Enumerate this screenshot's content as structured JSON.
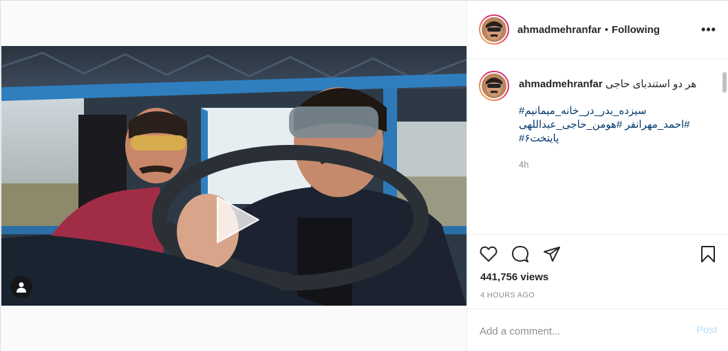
{
  "post": {
    "views": "441,756 views",
    "time_ago": "4 HOURS AGO"
  },
  "header": {
    "username": "ahmadmehranfar",
    "separator": "•",
    "follow_status": "Following",
    "more_label": "•••"
  },
  "caption": {
    "username": "ahmadmehranfar",
    "text": "هر دو استندبای حاجی",
    "hashtag_lines": [
      "#سیزده_بدر_در_خانه_میمانیم",
      "احمد_مهرانفر #هومن_حاجی_عبداللهی#",
      "#پایتخت۶"
    ],
    "time": "4h"
  },
  "actions": {
    "like_icon": "heart-icon",
    "comment_icon": "speech-bubble-icon",
    "share_icon": "paper-plane-icon",
    "save_icon": "bookmark-icon"
  },
  "comment_box": {
    "placeholder": "Add a comment...",
    "post_label": "Post"
  },
  "colors": {
    "link": "#00376b",
    "muted": "#8e8e8e",
    "post_disabled": "#b2dffc",
    "story_ring_start": "#f9c24d",
    "story_ring_end": "#c13584"
  }
}
